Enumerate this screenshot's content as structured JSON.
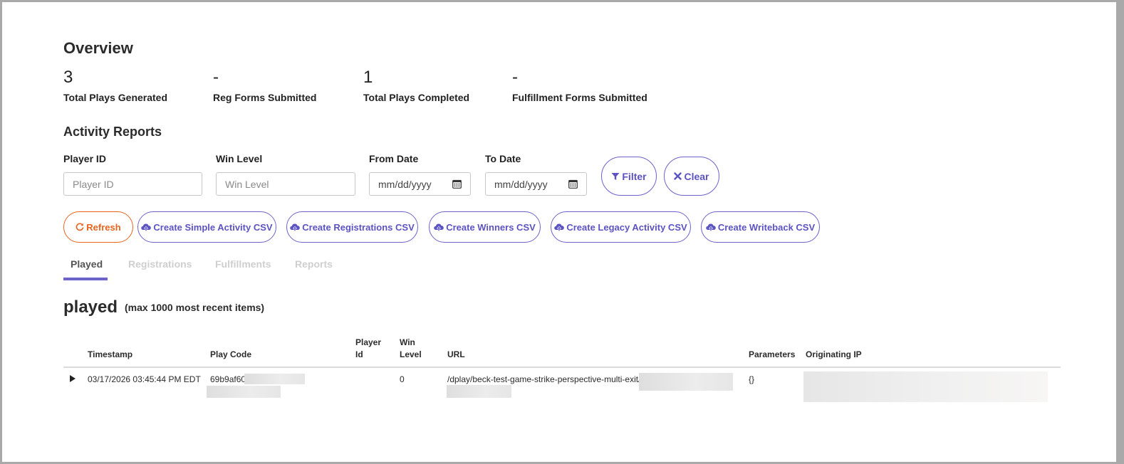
{
  "overview": {
    "title": "Overview",
    "stats": [
      {
        "value": "3",
        "label": "Total Plays Generated"
      },
      {
        "value": "-",
        "label": "Reg Forms Submitted"
      },
      {
        "value": "1",
        "label": "Total Plays Completed"
      },
      {
        "value": "-",
        "label": "Fulfillment Forms Submitted"
      }
    ]
  },
  "activity": {
    "title": "Activity Reports",
    "player_id": {
      "label": "Player ID",
      "placeholder": "Player ID"
    },
    "win_level": {
      "label": "Win Level",
      "placeholder": "Win Level"
    },
    "from_date": {
      "label": "From Date",
      "placeholder": "mm/dd/yyyy"
    },
    "to_date": {
      "label": "To Date",
      "placeholder": "mm/dd/yyyy"
    },
    "filter_label": "Filter",
    "clear_label": "Clear"
  },
  "actions": {
    "refresh": "Refresh",
    "simple_csv": "Create Simple Activity CSV",
    "registrations_csv": "Create Registrations CSV",
    "winners_csv": "Create Winners CSV",
    "legacy_csv": "Create Legacy Activity CSV",
    "writeback_csv": "Create Writeback CSV"
  },
  "tabs": [
    {
      "label": "Played",
      "active": true
    },
    {
      "label": "Registrations",
      "active": false
    },
    {
      "label": "Fulfillments",
      "active": false
    },
    {
      "label": "Reports",
      "active": false
    }
  ],
  "played": {
    "title": "played",
    "subtitle": "(max 1000 most recent items)",
    "columns": {
      "timestamp": "Timestamp",
      "play_code": "Play Code",
      "player_id_1": "Player",
      "player_id_2": "Id",
      "win_level_1": "Win",
      "win_level_2": "Level",
      "url": "URL",
      "parameters": "Parameters",
      "originating_ip": "Originating IP"
    },
    "rows": [
      {
        "timestamp": "03/17/2026 03:45:44 PM EDT",
        "play_code": "69b9af60",
        "player_id": "",
        "win_level": "0",
        "url": "/dplay/beck-test-game-strike-perspective-multi-exit/",
        "parameters": "{}",
        "originating_ip": ""
      }
    ]
  },
  "colors": {
    "accent": "#6b63c9",
    "refresh": "#e8641e",
    "tab_inactive": "#cfcfcf"
  }
}
